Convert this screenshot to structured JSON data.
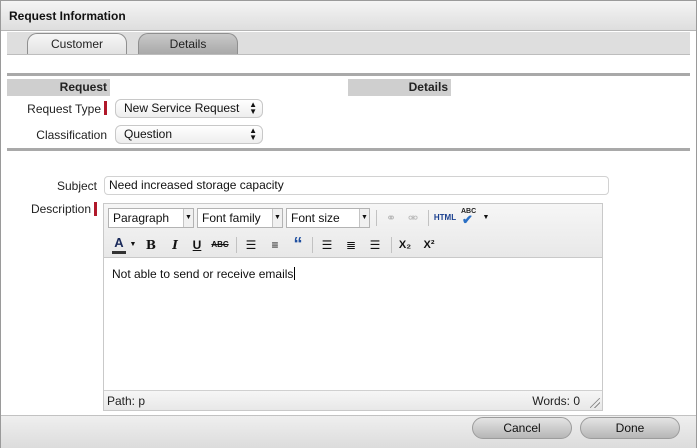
{
  "window": {
    "title": "Request Information"
  },
  "tabs": [
    {
      "label": "Customer"
    },
    {
      "label": "Details"
    }
  ],
  "columns": {
    "request": "Request",
    "details": "Details"
  },
  "fields": {
    "request_type": {
      "label": "Request Type",
      "value": "New Service Request",
      "required": true
    },
    "classification": {
      "label": "Classification",
      "value": "Question"
    },
    "subject": {
      "label": "Subject",
      "value": "Need increased storage capacity"
    },
    "description": {
      "label": "Description",
      "required": true
    }
  },
  "editor": {
    "format": "Paragraph",
    "font_family": "Font family",
    "font_size": "Font size",
    "html_label": "HTML",
    "spell_label": "ABC",
    "text_color_label": "A",
    "bold_label": "B",
    "italic_label": "I",
    "underline_label": "U",
    "strike_label": "ABC",
    "quote_label": "“",
    "subscript_label": "X₂",
    "superscript_label": "X²",
    "content": "Not able to send or receive emails",
    "path": "Path: p",
    "words": "Words: 0"
  },
  "buttons": {
    "cancel": "Cancel",
    "done": "Done"
  },
  "colors": {
    "required_marker": "#b0182a",
    "active_tab": "#b5b5b5"
  }
}
